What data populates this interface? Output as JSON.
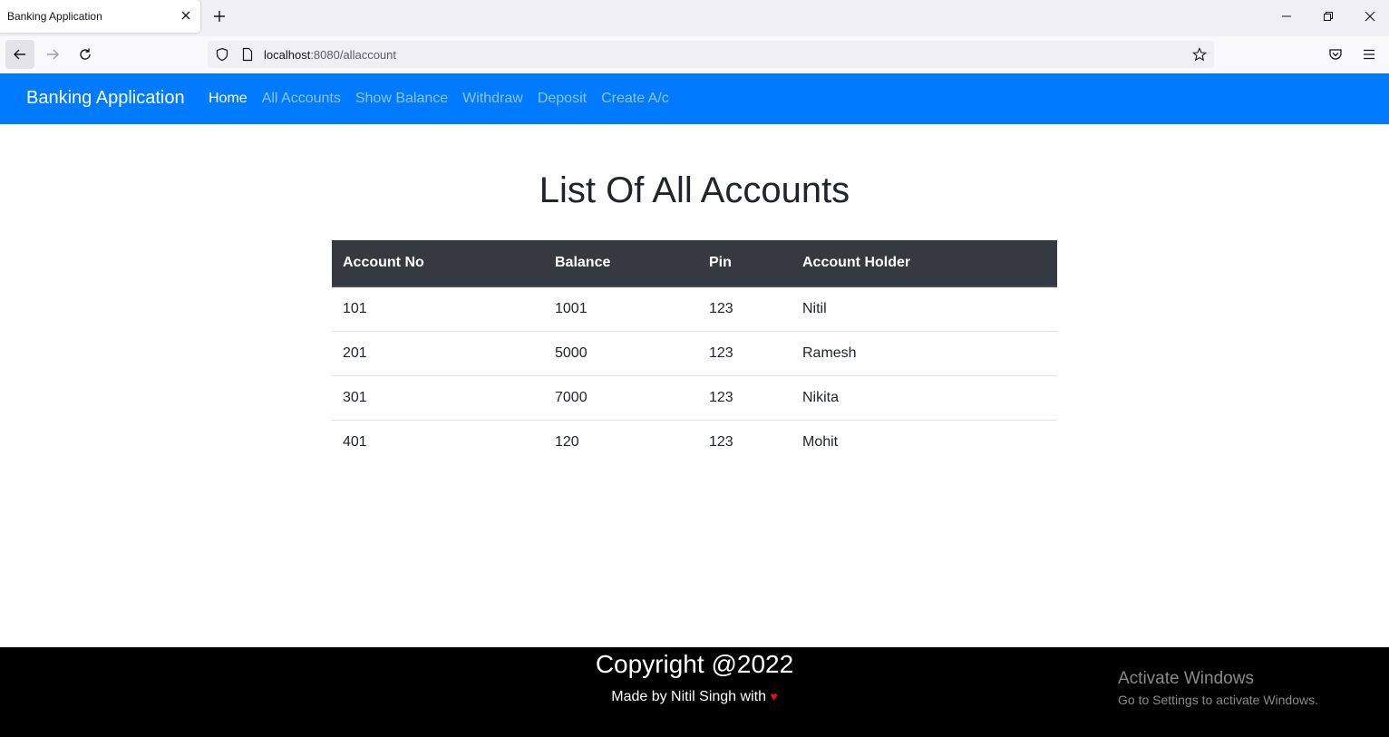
{
  "browser": {
    "tab_title": "Banking Application",
    "url_host": "localhost",
    "url_path": ":8080/allaccount"
  },
  "navbar": {
    "brand": "Banking Application",
    "links": [
      {
        "label": "Home",
        "active": true
      },
      {
        "label": "All Accounts",
        "active": false
      },
      {
        "label": "Show Balance",
        "active": false
      },
      {
        "label": "Withdraw",
        "active": false
      },
      {
        "label": "Deposit",
        "active": false
      },
      {
        "label": "Create A/c",
        "active": false
      }
    ],
    "bg_color": "#007bff"
  },
  "main": {
    "title": "List Of All Accounts",
    "table": {
      "headers": [
        "Account No",
        "Balance",
        "Pin",
        "Account Holder"
      ],
      "rows": [
        [
          "101",
          "1001",
          "123",
          "Nitil"
        ],
        [
          "201",
          "5000",
          "123",
          "Ramesh"
        ],
        [
          "301",
          "7000",
          "123",
          "Nikita"
        ],
        [
          "401",
          "120",
          "123",
          "Mohit"
        ]
      ],
      "header_bg": "#343a40"
    }
  },
  "footer": {
    "copyright": "Copyright @2022",
    "made_by": "Made by Nitil Singh with",
    "heart_icon": "heart-icon",
    "heart_color": "#e0141e"
  },
  "watermark": {
    "title": "Activate Windows",
    "subtitle": "Go to Settings to activate Windows."
  }
}
